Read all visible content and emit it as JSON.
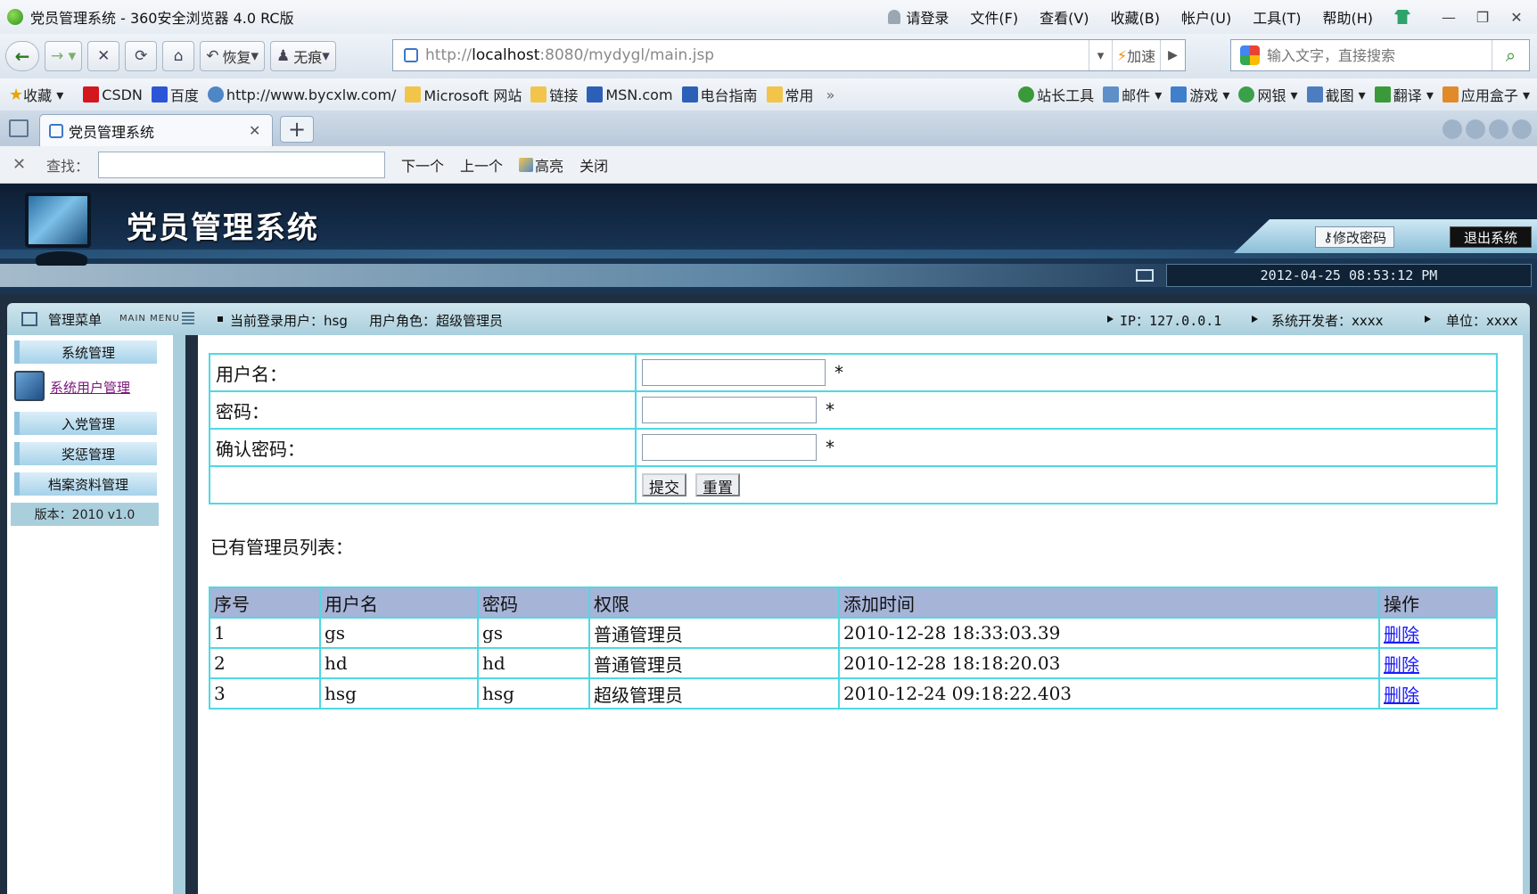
{
  "browser": {
    "window_title": "党员管理系统 - 360安全浏览器 4.0 RC版",
    "menu": [
      "请登录",
      "文件(F)",
      "查看(V)",
      "收藏(B)",
      "帐户(U)",
      "工具(T)",
      "帮助(H)"
    ],
    "nav": {
      "restore_label": "恢复",
      "private_label": "无痕"
    },
    "url_prefix": "http://",
    "url_host": "localhost",
    "url_rest": ":8080/mydygl/main.jsp",
    "accelerate_label": "加速",
    "search_placeholder": "输入文字，直接搜索",
    "bookmarks": [
      "收藏",
      "CSDN",
      "百度",
      "http://www.bycxlw.com/",
      "Microsoft 网站",
      "链接",
      "MSN.com",
      "电台指南",
      "常用"
    ],
    "bookmarks_more": "»",
    "tools": [
      "站长工具",
      "邮件",
      "游戏",
      "网银",
      "截图",
      "翻译",
      "应用盒子"
    ],
    "tab_title": "党员管理系统",
    "find": {
      "label": "查找：",
      "next": "下一个",
      "prev": "上一个",
      "highlight": "高亮",
      "close": "关闭"
    }
  },
  "app": {
    "title": "党员管理系统",
    "change_password": "修改密码",
    "logout": "退出系统",
    "datetime": "2012-04-25 08:53:12 PM",
    "menu_title": "管理菜单",
    "menu_subtitle": "MAIN MENU",
    "current_user": "当前登录用户：hsg",
    "user_role": "用户角色：超级管理员",
    "ip": "IP：127.0.0.1",
    "developer": "系统开发者：xxxx",
    "unit": "单位：xxxx",
    "sidebar": {
      "system": "系统管理",
      "system_user_link": "系统用户管理",
      "join_party": "入党管理",
      "rewards": "奖惩管理",
      "archives": "档案资料管理",
      "version": "版本：2010 v1.0"
    },
    "form": {
      "username_label": "用户名：",
      "password_label": "密码：",
      "confirm_label": "确认密码：",
      "required": "*",
      "submit": "提交",
      "reset": "重置"
    },
    "list_title": "已有管理员列表：",
    "table": {
      "headers": [
        "序号",
        "用户名",
        "密码",
        "权限",
        "添加时间",
        "操作"
      ],
      "rows": [
        [
          "1",
          "gs",
          "gs",
          "普通管理员",
          "2010-12-28 18:33:03.39",
          "删除"
        ],
        [
          "2",
          "hd",
          "hd",
          "普通管理员",
          "2010-12-28 18:18:20.03",
          "删除"
        ],
        [
          "3",
          "hsg",
          "hsg",
          "超级管理员",
          "2010-12-24 09:18:22.403",
          "删除"
        ]
      ]
    }
  }
}
